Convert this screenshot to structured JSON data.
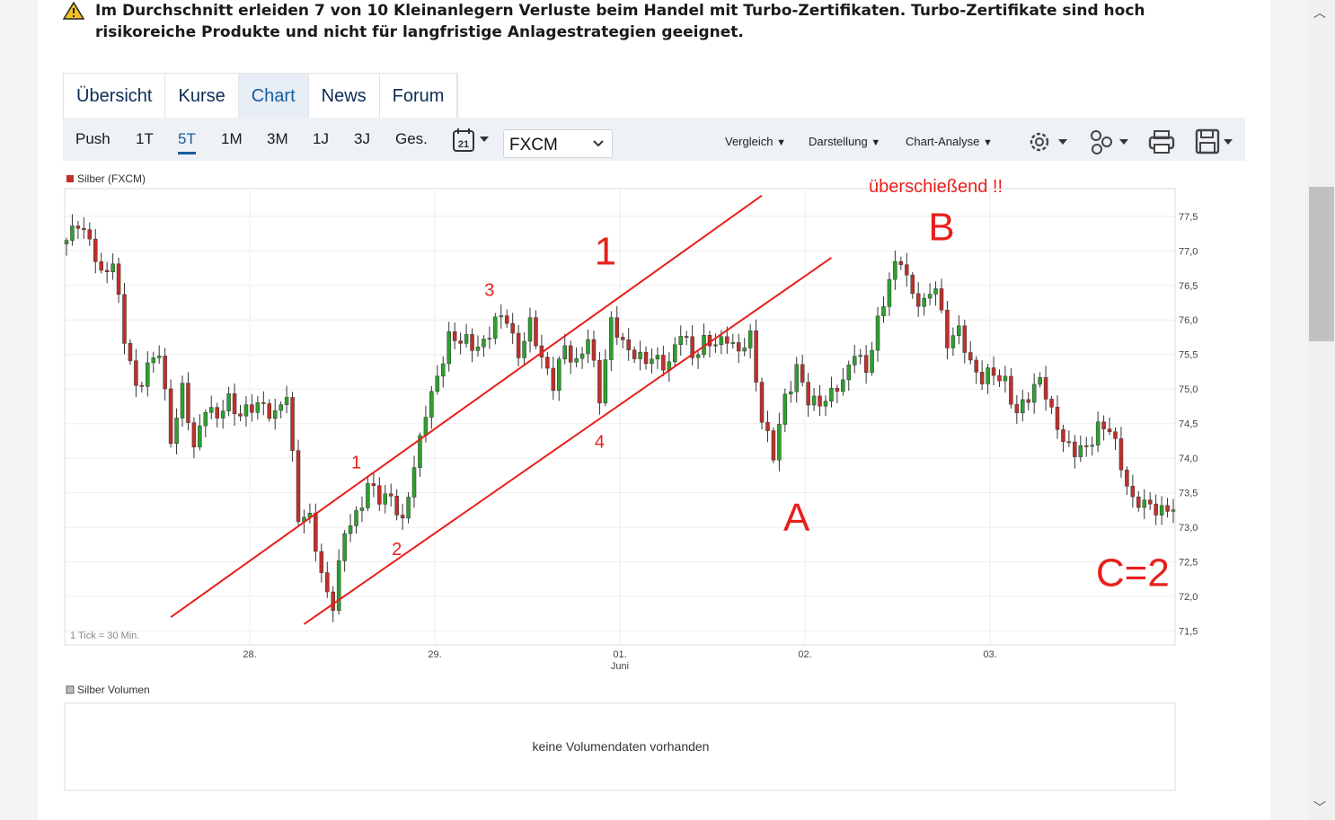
{
  "warning": {
    "text": "Im Durchschnitt erleiden 7 von 10 Kleinanlegern Verluste beim Handel mit Turbo-Zertifikaten. Turbo-Zertifikate sind hoch risikoreiche Produkte und nicht für langfristige Anlagestrategien geeignet.",
    "icon": "warning-triangle-icon"
  },
  "tabs": [
    {
      "label": "Übersicht",
      "active": false
    },
    {
      "label": "Kurse",
      "active": false
    },
    {
      "label": "Chart",
      "active": true
    },
    {
      "label": "News",
      "active": false
    },
    {
      "label": "Forum",
      "active": false
    }
  ],
  "toolbar": {
    "periods": [
      {
        "label": "Push",
        "active": false
      },
      {
        "label": "1T",
        "active": false
      },
      {
        "label": "5T",
        "active": true
      },
      {
        "label": "1M",
        "active": false
      },
      {
        "label": "3M",
        "active": false
      },
      {
        "label": "1J",
        "active": false
      },
      {
        "label": "3J",
        "active": false
      },
      {
        "label": "Ges.",
        "active": false
      }
    ],
    "calendar_day": "21",
    "exchange": "FXCM",
    "menus": [
      "Vergleich",
      "Darstellung",
      "Chart-Analyse"
    ]
  },
  "chart_data": {
    "type": "candlestick",
    "legend": "Silber (FXCM)",
    "tick_note": "1 Tick = 30 Min.",
    "accent_up": "#2ea02e",
    "accent_down": "#c0302b",
    "ylim": [
      71.3,
      77.9
    ],
    "y_ticks": [
      "77,5",
      "77,0",
      "76,5",
      "76,0",
      "75,5",
      "75,0",
      "74,5",
      "74,0",
      "73,5",
      "73,0",
      "72,5",
      "72,0",
      "71,5"
    ],
    "x_ticks": [
      {
        "label": "28.",
        "sub": ""
      },
      {
        "label": "29.",
        "sub": ""
      },
      {
        "label": "01.",
        "sub": "Juni"
      },
      {
        "label": "02.",
        "sub": ""
      },
      {
        "label": "03.",
        "sub": ""
      }
    ],
    "price_path": [
      [
        0,
        77.1
      ],
      [
        2,
        77.45
      ],
      [
        4,
        77.15
      ],
      [
        6,
        76.6
      ],
      [
        8,
        76.9
      ],
      [
        10,
        75.7
      ],
      [
        12,
        75.0
      ],
      [
        14,
        75.35
      ],
      [
        16,
        75.5
      ],
      [
        18,
        74.3
      ],
      [
        20,
        75.0
      ],
      [
        22,
        74.1
      ],
      [
        24,
        74.8
      ],
      [
        26,
        74.55
      ],
      [
        28,
        74.85
      ],
      [
        30,
        74.65
      ],
      [
        32,
        74.7
      ],
      [
        34,
        74.8
      ],
      [
        36,
        74.6
      ],
      [
        38,
        74.9
      ],
      [
        40,
        73.2
      ],
      [
        42,
        73.1
      ],
      [
        44,
        72.3
      ],
      [
        46,
        71.9
      ],
      [
        48,
        72.9
      ],
      [
        50,
        73.2
      ],
      [
        52,
        73.6
      ],
      [
        54,
        73.4
      ],
      [
        56,
        73.5
      ],
      [
        58,
        73.0
      ],
      [
        60,
        73.9
      ],
      [
        62,
        74.7
      ],
      [
        64,
        75.1
      ],
      [
        66,
        75.8
      ],
      [
        68,
        75.7
      ],
      [
        70,
        75.6
      ],
      [
        72,
        75.7
      ],
      [
        74,
        75.95
      ],
      [
        76,
        76.05
      ],
      [
        78,
        75.5
      ],
      [
        80,
        75.9
      ],
      [
        82,
        75.5
      ],
      [
        84,
        75.05
      ],
      [
        86,
        75.6
      ],
      [
        88,
        75.4
      ],
      [
        90,
        75.7
      ],
      [
        92,
        74.9
      ],
      [
        94,
        76.0
      ],
      [
        96,
        75.6
      ],
      [
        98,
        75.55
      ],
      [
        100,
        75.4
      ],
      [
        102,
        75.4
      ],
      [
        104,
        75.4
      ],
      [
        106,
        75.8
      ],
      [
        108,
        75.5
      ],
      [
        110,
        75.7
      ],
      [
        112,
        75.6
      ],
      [
        114,
        75.8
      ],
      [
        116,
        75.5
      ],
      [
        118,
        75.75
      ],
      [
        120,
        74.6
      ],
      [
        122,
        74.0
      ],
      [
        124,
        74.9
      ],
      [
        126,
        75.3
      ],
      [
        128,
        74.8
      ],
      [
        130,
        74.85
      ],
      [
        132,
        74.9
      ],
      [
        134,
        75.1
      ],
      [
        136,
        75.6
      ],
      [
        138,
        75.2
      ],
      [
        140,
        76.0
      ],
      [
        142,
        76.6
      ],
      [
        144,
        76.85
      ],
      [
        146,
        76.4
      ],
      [
        148,
        76.2
      ],
      [
        150,
        76.5
      ],
      [
        152,
        75.7
      ],
      [
        154,
        75.8
      ],
      [
        156,
        75.4
      ],
      [
        158,
        75.15
      ],
      [
        160,
        75.2
      ],
      [
        162,
        75.15
      ],
      [
        164,
        74.6
      ],
      [
        166,
        74.9
      ],
      [
        168,
        75.2
      ],
      [
        170,
        74.6
      ],
      [
        172,
        74.3
      ],
      [
        174,
        74.1
      ],
      [
        176,
        74.1
      ],
      [
        178,
        74.5
      ],
      [
        180,
        74.4
      ],
      [
        182,
        73.9
      ],
      [
        184,
        73.4
      ],
      [
        186,
        73.3
      ],
      [
        188,
        73.3
      ],
      [
        190,
        73.25
      ]
    ],
    "annotations": [
      {
        "text": "überschießend !!",
        "x": 150,
        "y": 77.85,
        "size": 20
      },
      {
        "text": "B",
        "x": 151,
        "y": 77.15,
        "size": 44
      },
      {
        "text": "1",
        "x": 93,
        "y": 76.8,
        "size": 44
      },
      {
        "text": "3",
        "x": 73,
        "y": 76.35,
        "size": 20
      },
      {
        "text": "4",
        "x": 92,
        "y": 74.15,
        "size": 20
      },
      {
        "text": "1",
        "x": 50,
        "y": 73.85,
        "size": 20
      },
      {
        "text": "2",
        "x": 57,
        "y": 72.6,
        "size": 20
      },
      {
        "text": "A",
        "x": 126,
        "y": 72.95,
        "size": 44
      },
      {
        "text": "C=2",
        "x": 184,
        "y": 72.15,
        "size": 44
      }
    ],
    "channel_lines": [
      {
        "from": [
          18,
          71.7
        ],
        "to": [
          120,
          77.8
        ]
      },
      {
        "from": [
          41,
          71.6
        ],
        "to": [
          132,
          76.9
        ]
      }
    ],
    "volume_legend": "Silber Volumen",
    "volume_message": "keine Volumendaten vorhanden"
  }
}
